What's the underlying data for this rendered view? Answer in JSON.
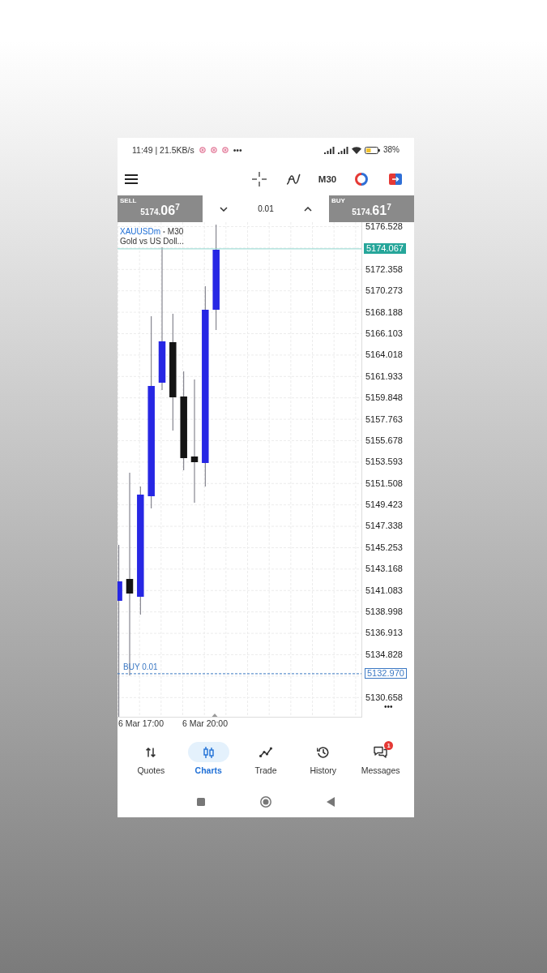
{
  "status_bar": {
    "text": "11:49 | 21.5KB/s",
    "more": "•••",
    "battery": "38%"
  },
  "toolbar": {
    "timeframe": "M30"
  },
  "trade_bar": {
    "sell": {
      "label": "SELL",
      "price": "5174.**06**$^{7}$"
    },
    "volume": "0.01",
    "buy": {
      "label": "BUY",
      "price": "5174.**61**$^{7}$"
    }
  },
  "chart": {
    "symbol": "XAUUSDm",
    "separator": "•",
    "timeframe": "M30",
    "description": "Gold vs US Doll...",
    "price_scale": [
      {
        "kind": "tick",
        "text": "5176.528"
      },
      {
        "kind": "current",
        "text": "5174.067"
      },
      {
        "kind": "tick",
        "text": "5172.358"
      },
      {
        "kind": "tick",
        "text": "5170.273"
      },
      {
        "kind": "tick",
        "text": "5168.188"
      },
      {
        "kind": "tick",
        "text": "5166.103"
      },
      {
        "kind": "tick",
        "text": "5164.018"
      },
      {
        "kind": "tick",
        "text": "5161.933"
      },
      {
        "kind": "tick",
        "text": "5159.848"
      },
      {
        "kind": "tick",
        "text": "5157.763"
      },
      {
        "kind": "tick",
        "text": "5155.678"
      },
      {
        "kind": "tick",
        "text": "5153.593"
      },
      {
        "kind": "tick",
        "text": "5151.508"
      },
      {
        "kind": "tick",
        "text": "5149.423"
      },
      {
        "kind": "tick",
        "text": "5147.338"
      },
      {
        "kind": "tick",
        "text": "5145.253"
      },
      {
        "kind": "tick",
        "text": "5143.168"
      },
      {
        "kind": "tick",
        "text": "5141.083"
      },
      {
        "kind": "tick",
        "text": "5138.998"
      },
      {
        "kind": "tick",
        "text": "5136.913"
      },
      {
        "kind": "tick",
        "text": "5134.828"
      },
      {
        "kind": "order",
        "text": "5132.970",
        "label": "BUY 0.01"
      },
      {
        "kind": "tick",
        "text": "5130.658"
      }
    ],
    "more": "•••",
    "time_labels": [
      "6 Mar 17:00",
      "6 Mar 20:00"
    ]
  },
  "bottom_nav": [
    {
      "label": "Quotes",
      "selected": false
    },
    {
      "label": "Charts",
      "selected": true
    },
    {
      "label": "Trade",
      "selected": false
    },
    {
      "label": "History",
      "selected": false
    },
    {
      "label": "Messages",
      "selected": false,
      "badge": "1"
    }
  ]
}
